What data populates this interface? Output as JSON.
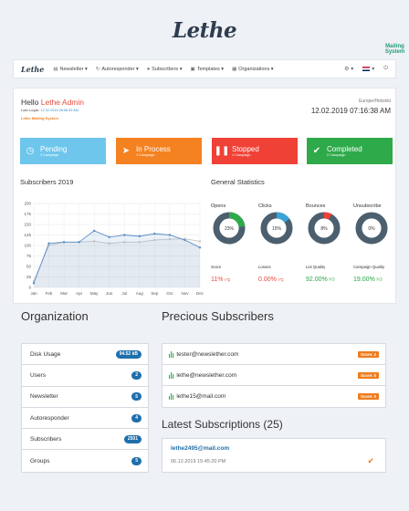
{
  "brand": {
    "name": "Lethe",
    "subtitle": "Mailing System"
  },
  "nav": {
    "logo": "Lethe",
    "items": [
      {
        "label": "Newsletter",
        "icon": "newspaper-icon"
      },
      {
        "label": "Autoresponder",
        "icon": "refresh-icon"
      },
      {
        "label": "Subscribers",
        "icon": "user-icon"
      },
      {
        "label": "Templates",
        "icon": "picture-icon"
      },
      {
        "label": "Organizations",
        "icon": "building-icon"
      }
    ],
    "right": [
      "gear-icon",
      "flag-uk-icon",
      "power-icon"
    ]
  },
  "greeting": {
    "hello": "Hello",
    "name": "Lethe Admin",
    "last_login_label": "Last Login:",
    "last_login_value": "12.02.2019 06:56:33 AM",
    "system": "Lethe Mailing System"
  },
  "clock": {
    "timezone": "Europe/Helsinki",
    "datetime": "12.02.2019 07:16:38 AM"
  },
  "status_cards": [
    {
      "title": "Pending",
      "sub": "3 Campaign",
      "color": "#6ec6ec"
    },
    {
      "title": "In Process",
      "sub": "1 Campaign",
      "color": "#f58220"
    },
    {
      "title": "Stopped",
      "sub": "1 Campaign",
      "color": "#ef4136"
    },
    {
      "title": "Completed",
      "sub": "2 Campaign",
      "color": "#2faa4a"
    }
  ],
  "subscribers_title": "Subscribers 2019",
  "chart_data": {
    "type": "line",
    "x": [
      "Jan",
      "Feb",
      "Mar",
      "Apr",
      "May",
      "Jun",
      "Jul",
      "Aug",
      "Sep",
      "Oct",
      "Nov",
      "Dec"
    ],
    "ylim": [
      0,
      200
    ],
    "yticks": [
      0,
      25,
      50,
      75,
      100,
      125,
      150,
      175,
      200
    ],
    "series": [
      {
        "values": [
          10,
          105,
          108,
          108,
          135,
          120,
          125,
          122,
          128,
          125,
          113,
          95
        ],
        "color": "#5b8fc7"
      },
      {
        "values": [
          15,
          100,
          108,
          108,
          110,
          105,
          108,
          108,
          113,
          115,
          116,
          110
        ],
        "color": "#c6c6c6"
      }
    ]
  },
  "general_title": "General Statistics",
  "donuts": [
    {
      "label": "Opens",
      "pct": "23%",
      "value": 0.23,
      "color": "#2faa4a"
    },
    {
      "label": "Clicks",
      "pct": "15%",
      "value": 0.15,
      "color": "#3aa3d8"
    },
    {
      "label": "Bounces",
      "pct": "8%",
      "value": 0.08,
      "color": "#ef4136"
    },
    {
      "label": "Unsubscribe",
      "pct": "0%",
      "value": 0.0,
      "color": "#f58220"
    }
  ],
  "metrics": [
    {
      "label": "Score",
      "value": "11%",
      "icon": "thumbs-down-icon",
      "good": false
    },
    {
      "label": "Losses",
      "value": "0.00%",
      "icon": "thumbs-down-icon",
      "good": false
    },
    {
      "label": "List Quality",
      "value": "92.00%",
      "icon": "thumbs-up-icon",
      "good": true
    },
    {
      "label": "Campaign Quality",
      "value": "19.00%",
      "icon": "thumbs-up-icon",
      "good": true
    }
  ],
  "organization": {
    "title": "Organization",
    "rows": [
      {
        "label": "Disk Usage",
        "badge": "94.52 kB"
      },
      {
        "label": "Users",
        "badge": "2"
      },
      {
        "label": "Newsletter",
        "badge": "5"
      },
      {
        "label": "Autoresponder",
        "badge": "4"
      },
      {
        "label": "Subscribers",
        "badge": "2501"
      },
      {
        "label": "Groups",
        "badge": "5"
      }
    ]
  },
  "precious": {
    "title": "Precious Subscribers",
    "rows": [
      {
        "email": "tester@newslether.com",
        "score": "Score: 2"
      },
      {
        "email": "lethe@newslether.com",
        "score": "Score: 0"
      },
      {
        "email": "lethe15@mail.com",
        "score": "Score: 0"
      }
    ]
  },
  "latest": {
    "title": "Latest Subscriptions (25)",
    "email": "lethe2495@mail.com",
    "date": "06.12.2019 15:45:20 PM"
  }
}
